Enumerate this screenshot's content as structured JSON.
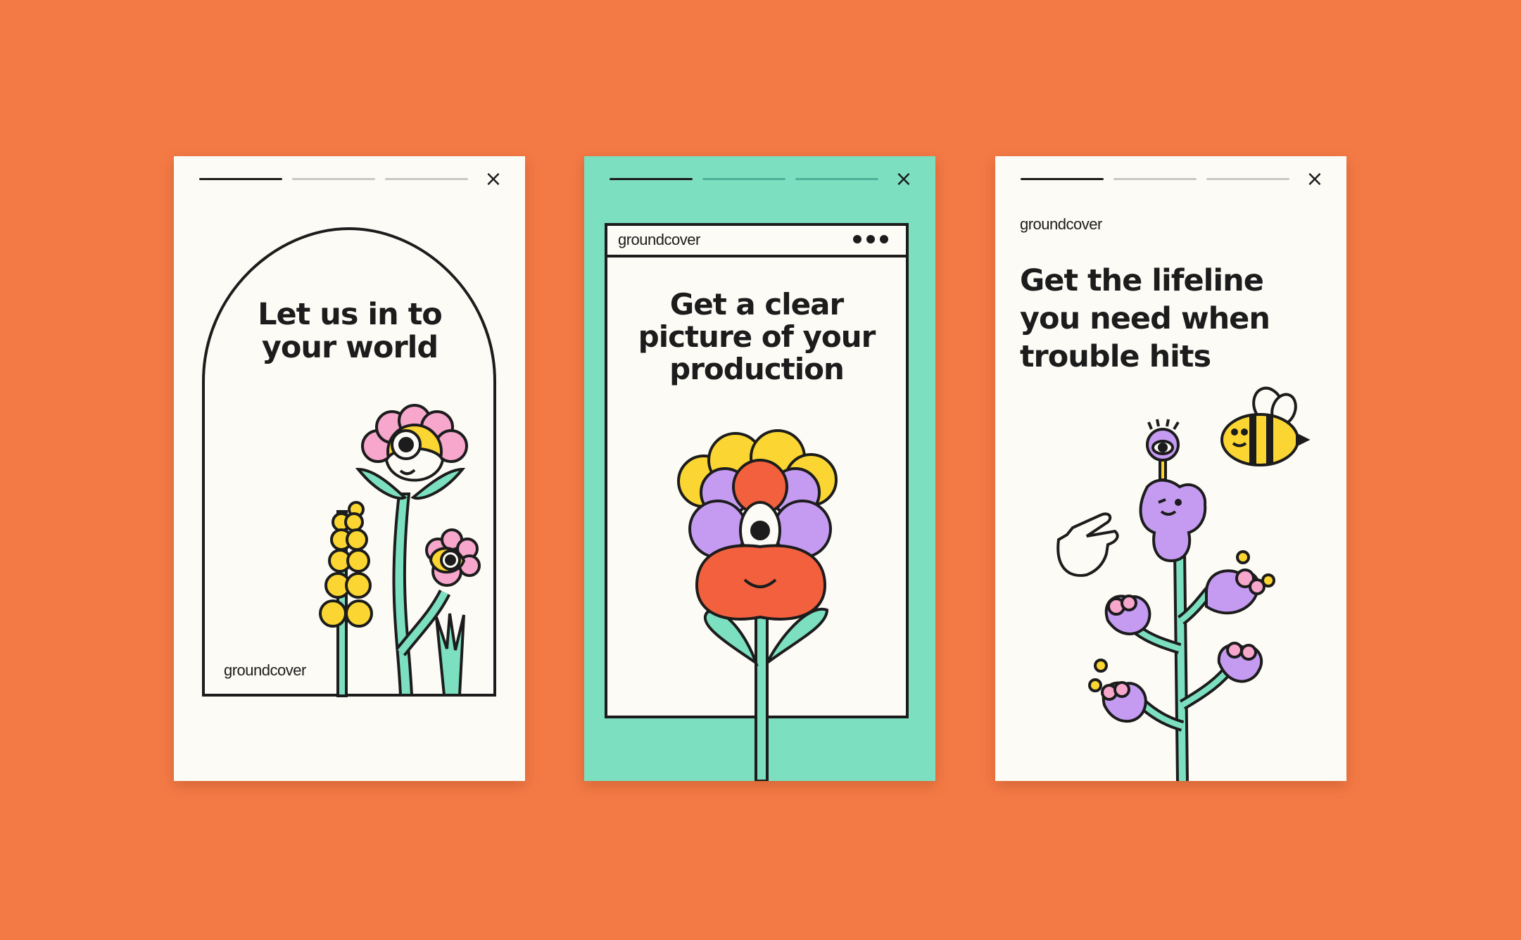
{
  "colors": {
    "background": "#f47a45",
    "card_cream": "#fdfbf5",
    "card_teal": "#7cdfc0",
    "ink": "#1c1c1c"
  },
  "cards": [
    {
      "headline_lines": [
        "Let us in to",
        "your world"
      ],
      "logo": "groundcover",
      "close_icon": "×",
      "progress_active_step": 1,
      "progress_steps": 3
    },
    {
      "headline_lines": [
        "Get a clear",
        "picture of your",
        "production"
      ],
      "logo": "groundcover",
      "close_icon": "×",
      "progress_active_step": 1,
      "progress_steps": 3
    },
    {
      "headline_lines": [
        "Get the lifeline",
        "you need when",
        "trouble hits"
      ],
      "logo": "groundcover",
      "close_icon": "×",
      "progress_active_step": 1,
      "progress_steps": 3
    }
  ],
  "icons": [
    "close-icon",
    "window-dots-icon",
    "flower-illustration",
    "bee-illustration",
    "pointing-hand-icon"
  ]
}
